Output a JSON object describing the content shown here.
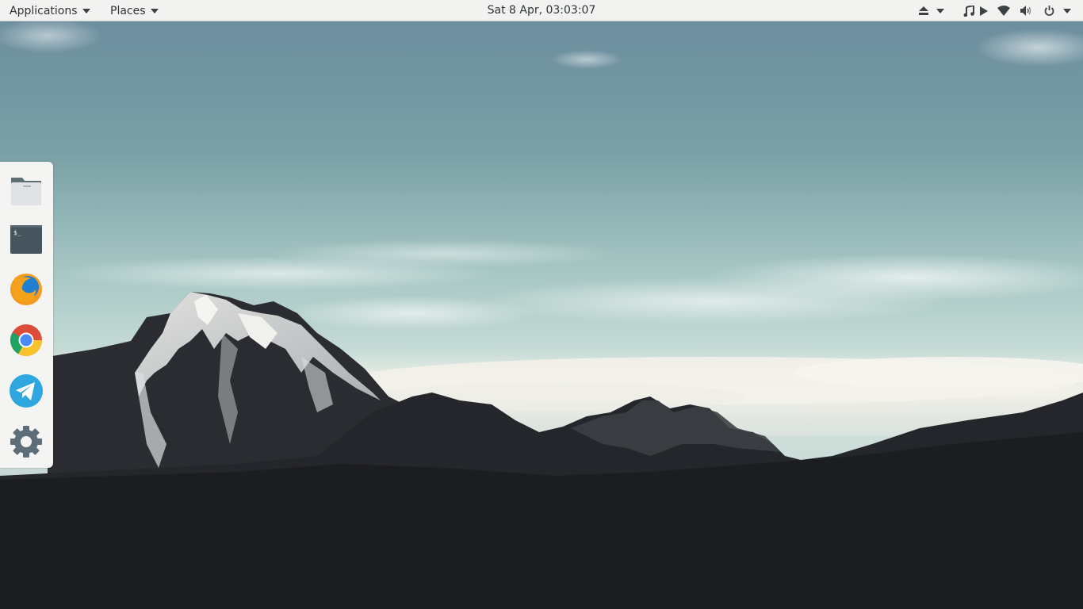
{
  "topbar": {
    "applications_label": "Applications",
    "places_label": "Places",
    "clock": "Sat  8 Apr, 03:03:07",
    "tray_icons": [
      "eject-icon",
      "dropdown-arrow",
      "music-note-icon",
      "play-icon",
      "wifi-icon",
      "volume-icon",
      "power-icon",
      "dropdown-arrow"
    ]
  },
  "dock": {
    "items": [
      {
        "name": "files",
        "icon": "folder-icon"
      },
      {
        "name": "terminal",
        "icon": "terminal-icon",
        "glyph": "$_"
      },
      {
        "name": "firefox",
        "icon": "firefox-icon"
      },
      {
        "name": "chrome",
        "icon": "chrome-icon"
      },
      {
        "name": "telegram",
        "icon": "telegram-icon"
      },
      {
        "name": "settings",
        "icon": "gear-icon"
      }
    ]
  },
  "colors": {
    "topbar_bg": "#f2f2f0",
    "dock_bg": "#f4f4f2",
    "sky_top": "#6f8ea0",
    "sky_bottom": "#cfe1dc",
    "mountain_dark": "#1e1f23"
  },
  "wallpaper": "mountain-landscape"
}
